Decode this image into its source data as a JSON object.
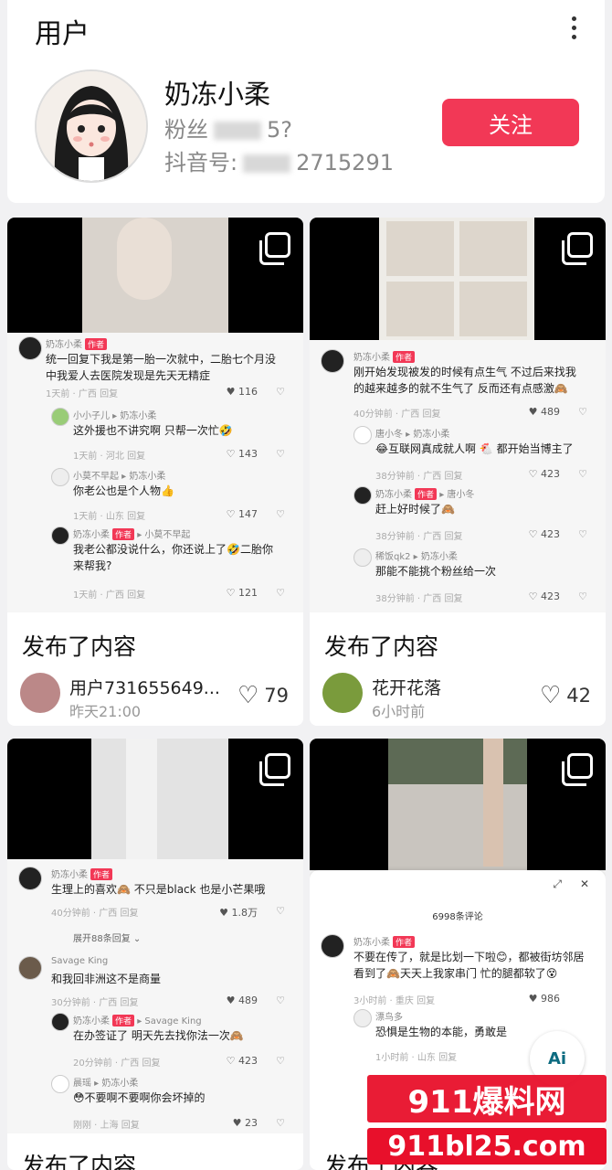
{
  "header": {
    "title": "用户"
  },
  "user": {
    "name": "奶冻小柔",
    "fans_label": "粉丝",
    "fans_visible": "5?",
    "id_label": "抖音号:",
    "id_visible": "2715291",
    "follow_label": "关注"
  },
  "posts": [
    {
      "label": "发布了内容",
      "author": "用户731655649...",
      "time": "昨天21:00",
      "likes": "79",
      "comments": [
        {
          "name": "奶冻小柔",
          "tag": "作者",
          "text": "统一回复下我是第一胎一次就中，二胎七个月没中我爱人去医院发现是先天无精症",
          "meta": "1天前 · 广西   回复",
          "likes": "116",
          "liked": true
        },
        {
          "name": "小小子儿 ▸ 奶冻小柔",
          "text": "这外援也不讲究啊 只帮一次忙🤣",
          "meta": "1天前 · 河北   回复",
          "likes": "143"
        },
        {
          "name": "小莫不早起 ▸ 奶冻小柔",
          "text": "你老公也是个人物👍",
          "meta": "1天前 · 山东   回复",
          "likes": "147"
        },
        {
          "name": "奶冻小柔",
          "tag": "作者",
          "name_suffix": "▸ 小莫不早起",
          "text": "我老公都没说什么，你还说上了🤣二胎你来帮我?",
          "meta": "1天前 · 广西   回复",
          "likes": "121"
        }
      ]
    },
    {
      "label": "发布了内容",
      "author": "花开花落",
      "time": "6小时前",
      "likes": "42",
      "comments": [
        {
          "name": "奶冻小柔",
          "tag": "作者",
          "text": "刚开始发现被发的时候有点生气 不过后来找我的越来越多的就不生气了 反而还有点感激🙈",
          "meta": "40分钟前 · 广西   回复",
          "likes": "489",
          "liked": true
        },
        {
          "name": "唐小冬 ▸ 奶冻小柔",
          "text": "😂互联网真成就人啊 🐔 都开始当博主了",
          "meta": "38分钟前 · 广西   回复",
          "likes": "423"
        },
        {
          "name": "奶冻小柔",
          "tag": "作者",
          "name_suffix": "▸ 唐小冬",
          "text": "赶上好时候了🙈",
          "meta": "38分钟前 · 广西   回复",
          "likes": "423"
        },
        {
          "name": "稀饭qk2 ▸ 奶冻小柔",
          "text": "那能不能挑个粉丝给一次",
          "meta": "38分钟前 · 广西   回复",
          "likes": "423"
        }
      ]
    },
    {
      "label": "发布了内容",
      "comments": [
        {
          "name": "奶冻小柔",
          "tag": "作者",
          "text": "生理上的喜欢🙈 不只是black 也是小芒果哦",
          "meta": "40分钟前 · 广西   回复",
          "likes": "1.8万",
          "liked": true
        },
        {
          "name": "展开88条回复 ⌄",
          "is_expand": true
        },
        {
          "name": "Savage King",
          "text": "和我回非洲这不是商量",
          "meta": "30分钟前 · 广西   回复",
          "likes": "489",
          "liked": true
        },
        {
          "name": "奶冻小柔",
          "tag": "作者",
          "name_suffix": "▸ Savage King",
          "text": "在办签证了 明天先去找你法一次🙈",
          "meta": "20分钟前 · 广西   回复",
          "likes": "423"
        },
        {
          "name": "晨瑶 ▸ 奶冻小柔",
          "text": "😳不要啊不要啊你会坏掉的",
          "meta": "刚刚 · 上海   回复",
          "likes": "23",
          "liked": true
        }
      ]
    },
    {
      "label": "发布了内容",
      "popup_count": "6998条评论",
      "comments": [
        {
          "name": "奶冻小柔",
          "tag": "作者",
          "text": "不要在传了，就是比划一下啦😊，都被街坊邻居看到了🙈天天上我家串门 忙的腿都软了😵",
          "meta": "3小时前 · 重庆   回复",
          "likes": "986",
          "liked": true
        },
        {
          "name": "漂鸟多",
          "text": "恐惧是生物的本能，勇敢是",
          "meta": "1小时前 · 山东   回复",
          "likes": ""
        }
      ]
    }
  ],
  "ai_button": "Ai",
  "watermark": {
    "line1": "911爆料网",
    "line2": "911bl25.com"
  },
  "colors": {
    "accent": "#f23856",
    "heart": "#e3334b",
    "watermark": "#e8102b"
  }
}
